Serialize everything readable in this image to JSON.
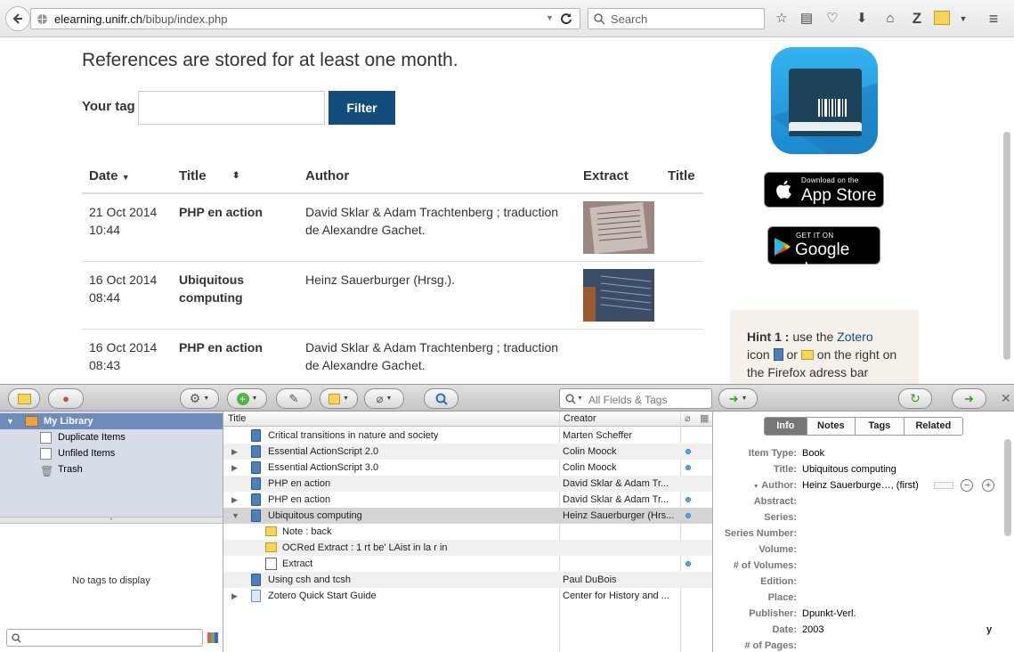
{
  "browser": {
    "url_host": "elearning.unifr.ch",
    "url_path": "/bibup/index.php",
    "search_placeholder": "Search",
    "toolbar_icons": [
      "star-icon",
      "reading-list-icon",
      "pocket-icon",
      "download-icon",
      "home-icon",
      "zotero-icon",
      "zotero-folder-icon",
      "menu-icon"
    ]
  },
  "page": {
    "notice": "References are stored for at least one month.",
    "tag_label": "Your tag",
    "filter_button": "Filter",
    "table": {
      "headers": [
        "Date",
        "Title",
        "Author",
        "Extract",
        "Title"
      ],
      "rows": [
        {
          "date": "21 Oct 2014",
          "time": "10:44",
          "title": "PHP en action",
          "title2": "",
          "author1": "David Sklar & Adam Trachtenberg ; traduction",
          "author2": "de Alexandre Gachet."
        },
        {
          "date": "16 Oct 2014",
          "time": "08:44",
          "title": "Ubiquitous",
          "title2": "computing",
          "author1": "Heinz Sauerburger (Hrsg.).",
          "author2": ""
        },
        {
          "date": "16 Oct 2014",
          "time": "08:43",
          "title": "PHP en action",
          "title2": "",
          "author1": "David Sklar & Adam Trachtenberg ; traduction",
          "author2": "de Alexandre Gachet."
        }
      ]
    },
    "appstore": {
      "small": "Download on the",
      "big": "App Store"
    },
    "googleplay": {
      "small": "GET IT ON",
      "big": "Google play"
    },
    "hint": {
      "label": "Hint 1 :",
      "t1": " use the ",
      "zotero": "Zotero",
      "t2": "icon ",
      "t3": " or ",
      "t4": " on the right on the Firefox adress bar"
    }
  },
  "zotero": {
    "search_placeholder": "All Fields & Tags",
    "collections": {
      "my_library": "My Library",
      "duplicate": "Duplicate Items",
      "unfiled": "Unfiled Items",
      "trash": "Trash"
    },
    "no_tags": "No tags to display",
    "columns": {
      "title": "Title",
      "creator": "Creator"
    },
    "items": [
      {
        "title": "Critical transitions in nature and society",
        "creator": "Marten Scheffer"
      },
      {
        "title": "Essential ActionScript 2.0",
        "creator": "Colin Moock"
      },
      {
        "title": "Essential ActionScript 3.0",
        "creator": "Colin Moock"
      },
      {
        "title": "PHP en action",
        "creator": "David Sklar & Adam Tr..."
      },
      {
        "title": "PHP en action",
        "creator": "David Sklar & Adam Tr..."
      },
      {
        "title": "Ubiquitous computing",
        "creator": "Heinz Sauerburger (Hrs..."
      },
      {
        "title": "Note : back",
        "creator": ""
      },
      {
        "title": "OCRed Extract : 1 rt be' LAist in la r in",
        "creator": ""
      },
      {
        "title": "Extract",
        "creator": ""
      },
      {
        "title": "Using csh and tcsh",
        "creator": "Paul DuBois"
      },
      {
        "title": "Zotero Quick Start Guide",
        "creator": "Center for History and ..."
      }
    ],
    "tabs": [
      "Info",
      "Notes",
      "Tags",
      "Related"
    ],
    "fields": [
      {
        "label": "Item Type:",
        "value": "Book"
      },
      {
        "label": "Title:",
        "value": "Ubiquitous computing"
      },
      {
        "label": "Author:",
        "value": "Heinz Sauerburge…, (first)"
      },
      {
        "label": "Abstract:",
        "value": ""
      },
      {
        "label": "Series:",
        "value": ""
      },
      {
        "label": "Series Number:",
        "value": ""
      },
      {
        "label": "Volume:",
        "value": ""
      },
      {
        "label": "# of Volumes:",
        "value": ""
      },
      {
        "label": "Edition:",
        "value": ""
      },
      {
        "label": "Place:",
        "value": ""
      },
      {
        "label": "Publisher:",
        "value": "Dpunkt-Verl."
      },
      {
        "label": "Date:",
        "value": "2003"
      },
      {
        "label": "# of Pages:",
        "value": ""
      }
    ],
    "date_flag": "y"
  }
}
